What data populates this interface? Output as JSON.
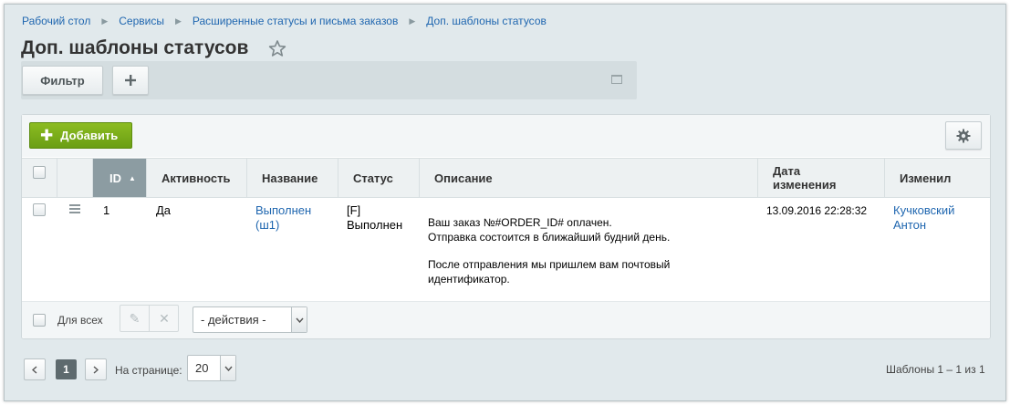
{
  "breadcrumb": [
    "Рабочий стол",
    "Сервисы",
    "Расширенные статусы и письма заказов",
    "Доп. шаблоны статусов"
  ],
  "page_title": "Доп. шаблоны статусов",
  "filter": {
    "filter_label": "Фильтр",
    "plus_label": "+"
  },
  "toolbar": {
    "add_label": "Добавить"
  },
  "columns": [
    "ID",
    "Активность",
    "Название",
    "Статус",
    "Описание",
    "Дата изменения",
    "Изменил"
  ],
  "columns_split": {
    "date_line1": "Дата",
    "date_line2": "изменения"
  },
  "rows": [
    {
      "id": "1",
      "active": "Да",
      "name_line1": "Выполнен",
      "name_line2": "(ш1)",
      "status_line1": "[F]",
      "status_line2": "Выполнен",
      "desc_line1": "Ваш заказ №#ORDER_ID# оплачен.",
      "desc_line2": "Отправка состоится в ближайший будний день.",
      "desc_line3": "После отправления мы пришлем вам почтовый",
      "desc_line4": "идентификатор.",
      "date": "13.09.2016 22:28:32",
      "editor_line1": "Кучковский",
      "editor_line2": "Антон"
    }
  ],
  "grid_footer": {
    "for_all_label": "Для всех",
    "actions_select": "- действия -"
  },
  "pagination": {
    "current_page": "1",
    "per_page_label": "На странице:",
    "per_page_value": "20",
    "counter": "Шаблоны 1 – 1 из 1"
  },
  "colors": {
    "accent_green": "#7aad1a",
    "link_blue": "#2067b0",
    "sorted_header": "#8c9ca2"
  },
  "icons": [
    "star-icon",
    "plus-icon",
    "window-icon",
    "gear-icon",
    "sort-asc-icon",
    "drag-handle-icon",
    "pencil-icon",
    "close-icon",
    "chevron-left-icon",
    "chevron-right-icon",
    "chevron-down-icon"
  ]
}
